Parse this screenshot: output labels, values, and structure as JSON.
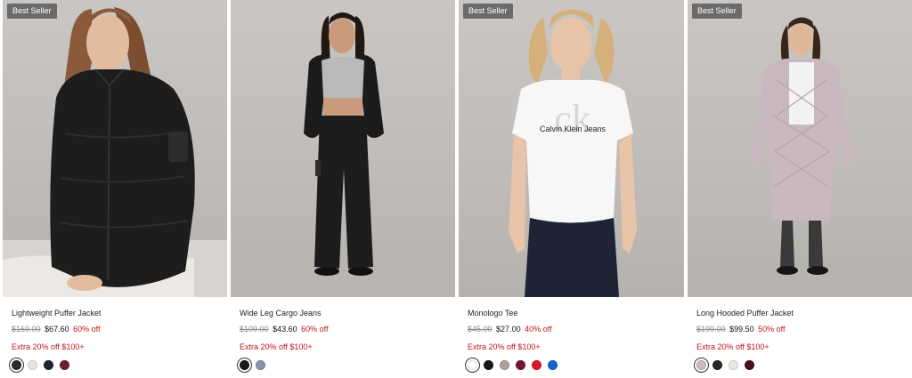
{
  "products": [
    {
      "badge": "Best Seller",
      "name": "Lightweight Puffer Jacket",
      "old_price": "$169.00",
      "new_price": "$67.60",
      "discount": "60% off",
      "promo": "Extra 20% off $100+",
      "swatches": [
        "#2b2b2b",
        "#e6e4e1",
        "#1f2433",
        "#6a1f2e"
      ]
    },
    {
      "badge": "",
      "name": "Wide Leg Cargo Jeans",
      "old_price": "$109.00",
      "new_price": "$43.60",
      "discount": "60% off",
      "promo": "Extra 20% off $100+",
      "swatches": [
        "#1b1b1b",
        "#8594a8"
      ]
    },
    {
      "badge": "Best Seller",
      "name": "Monologo Tee",
      "old_price": "$45.00",
      "new_price": "$27.00",
      "discount": "40% off",
      "promo": "Extra 20% off $100+",
      "swatches": [
        "#ffffff",
        "#161616",
        "#a9a29b",
        "#7a1230",
        "#e0112b",
        "#1465d0"
      ]
    },
    {
      "badge": "Best Seller",
      "name": "Long Hooded Puffer Jacket",
      "old_price": "$199.00",
      "new_price": "$99.50",
      "discount": "50% off",
      "promo": "Extra 20% off $100+",
      "swatches": [
        "#cbb9c0",
        "#2a2422",
        "#e9e6e1",
        "#4b1218"
      ]
    }
  ],
  "tee_print": "Calvin Klein Jeans",
  "colors": {
    "discount_red": "#c0161e",
    "badge_bg": "#6b6b6b"
  }
}
